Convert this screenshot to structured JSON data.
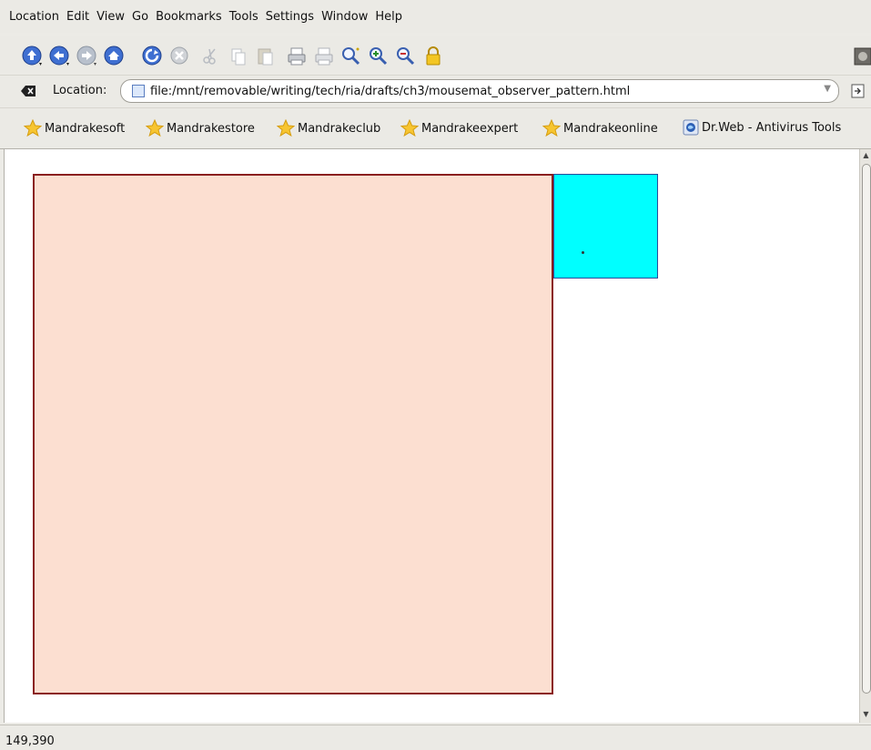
{
  "menu": {
    "items": [
      "Location",
      "Edit",
      "View",
      "Go",
      "Bookmarks",
      "Tools",
      "Settings",
      "Window",
      "Help"
    ]
  },
  "toolbar": {
    "icons": [
      "up-icon",
      "back-icon",
      "forward-icon",
      "home-icon",
      "reload-icon",
      "stop-icon",
      "cut-icon",
      "copy-icon",
      "paste-icon",
      "print-icon",
      "print-preview-icon",
      "find-icon",
      "zoom-in-icon",
      "zoom-out-icon",
      "lock-icon"
    ]
  },
  "location": {
    "label": "Location:",
    "url": "file:/mnt/removable/writing/tech/ria/drafts/ch3/mousemat_observer_pattern.html"
  },
  "bookmarks": {
    "items": [
      "Mandrakesoft",
      "Mandrakestore",
      "Mandrakeclub",
      "Mandrakeexpert",
      "Mandrakeonline",
      "Dr.Web - Antivirus Tools"
    ]
  },
  "colors": {
    "mousemat_fill": "#fcdfd1",
    "mousemat_border": "#8a1f1f",
    "cursor_box_fill": "#00ffff",
    "cursor_box_border": "#2a4a9a"
  },
  "status": {
    "text": "149,390"
  }
}
